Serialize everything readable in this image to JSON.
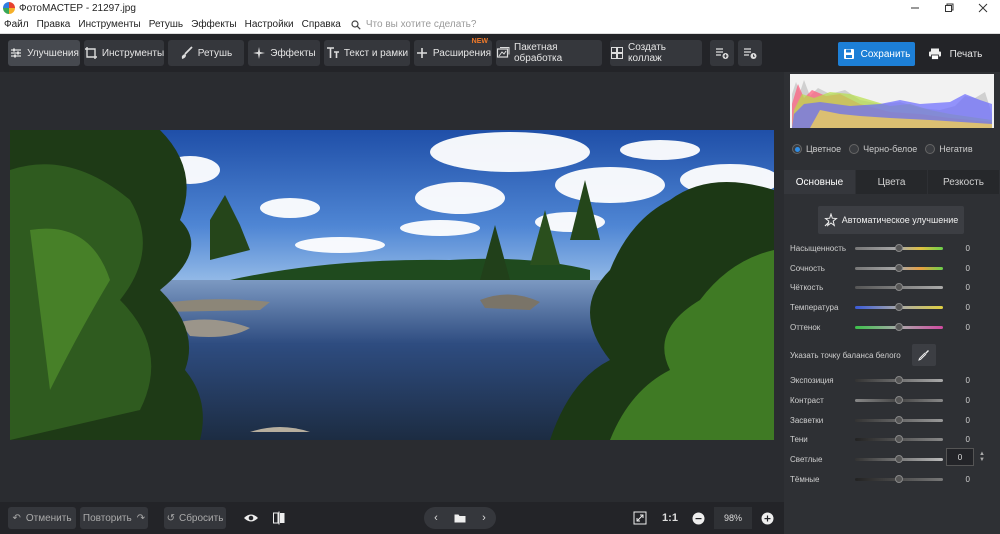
{
  "window": {
    "title": "ФотоМАСТЕР - 21297.jpg"
  },
  "menu": {
    "items": [
      "Файл",
      "Правка",
      "Инструменты",
      "Ретушь",
      "Эффекты",
      "Настройки",
      "Справка"
    ],
    "search_placeholder": "Что вы хотите сделать?"
  },
  "toolbar": {
    "tabs": [
      {
        "label": "Улучшения",
        "icon": "sliders-icon",
        "active": true
      },
      {
        "label": "Инструменты",
        "icon": "crop-icon"
      },
      {
        "label": "Ретушь",
        "icon": "brush-icon"
      },
      {
        "label": "Эффекты",
        "icon": "sparkle-icon"
      },
      {
        "label": "Текст и рамки",
        "icon": "text-icon"
      },
      {
        "label": "Расширения",
        "icon": "plus-icon",
        "badge": "NEW"
      },
      {
        "label": "Пакетная обработка",
        "icon": "images-icon"
      },
      {
        "label": "Создать коллаж",
        "icon": "collage-icon"
      }
    ],
    "save_label": "Сохранить",
    "print_label": "Печать"
  },
  "bottom": {
    "undo_label": "Отменить",
    "redo_label": "Повторить",
    "reset_label": "Сбросить",
    "ratio_label": "1:1",
    "zoom_value": "98%"
  },
  "panel": {
    "modes": [
      {
        "label": "Цветное",
        "selected": true
      },
      {
        "label": "Черно-белое",
        "selected": false
      },
      {
        "label": "Негатив",
        "selected": false
      }
    ],
    "tabs": [
      {
        "label": "Основные",
        "active": true
      },
      {
        "label": "Цвета",
        "active": false
      },
      {
        "label": "Резкость",
        "active": false
      }
    ],
    "auto_label": "Автоматическое улучшение",
    "wb_label": "Указать точку баланса белого",
    "sliders_top": [
      {
        "label": "Насыщенность",
        "value": "0"
      },
      {
        "label": "Сочность",
        "value": "0"
      },
      {
        "label": "Чёткость",
        "value": "0"
      },
      {
        "label": "Температура",
        "value": "0"
      },
      {
        "label": "Оттенок",
        "value": "0"
      }
    ],
    "sliders_bottom": [
      {
        "label": "Экспозиция",
        "value": "0"
      },
      {
        "label": "Контраст",
        "value": "0"
      },
      {
        "label": "Засветки",
        "value": "0"
      },
      {
        "label": "Тени",
        "value": "0"
      },
      {
        "label": "Светлые",
        "value": "0"
      },
      {
        "label": "Тёмные",
        "value": "0"
      }
    ],
    "spin_value": "0"
  },
  "colors": {
    "accent": "#1d7fd6",
    "new_badge": "#f07a2a"
  }
}
